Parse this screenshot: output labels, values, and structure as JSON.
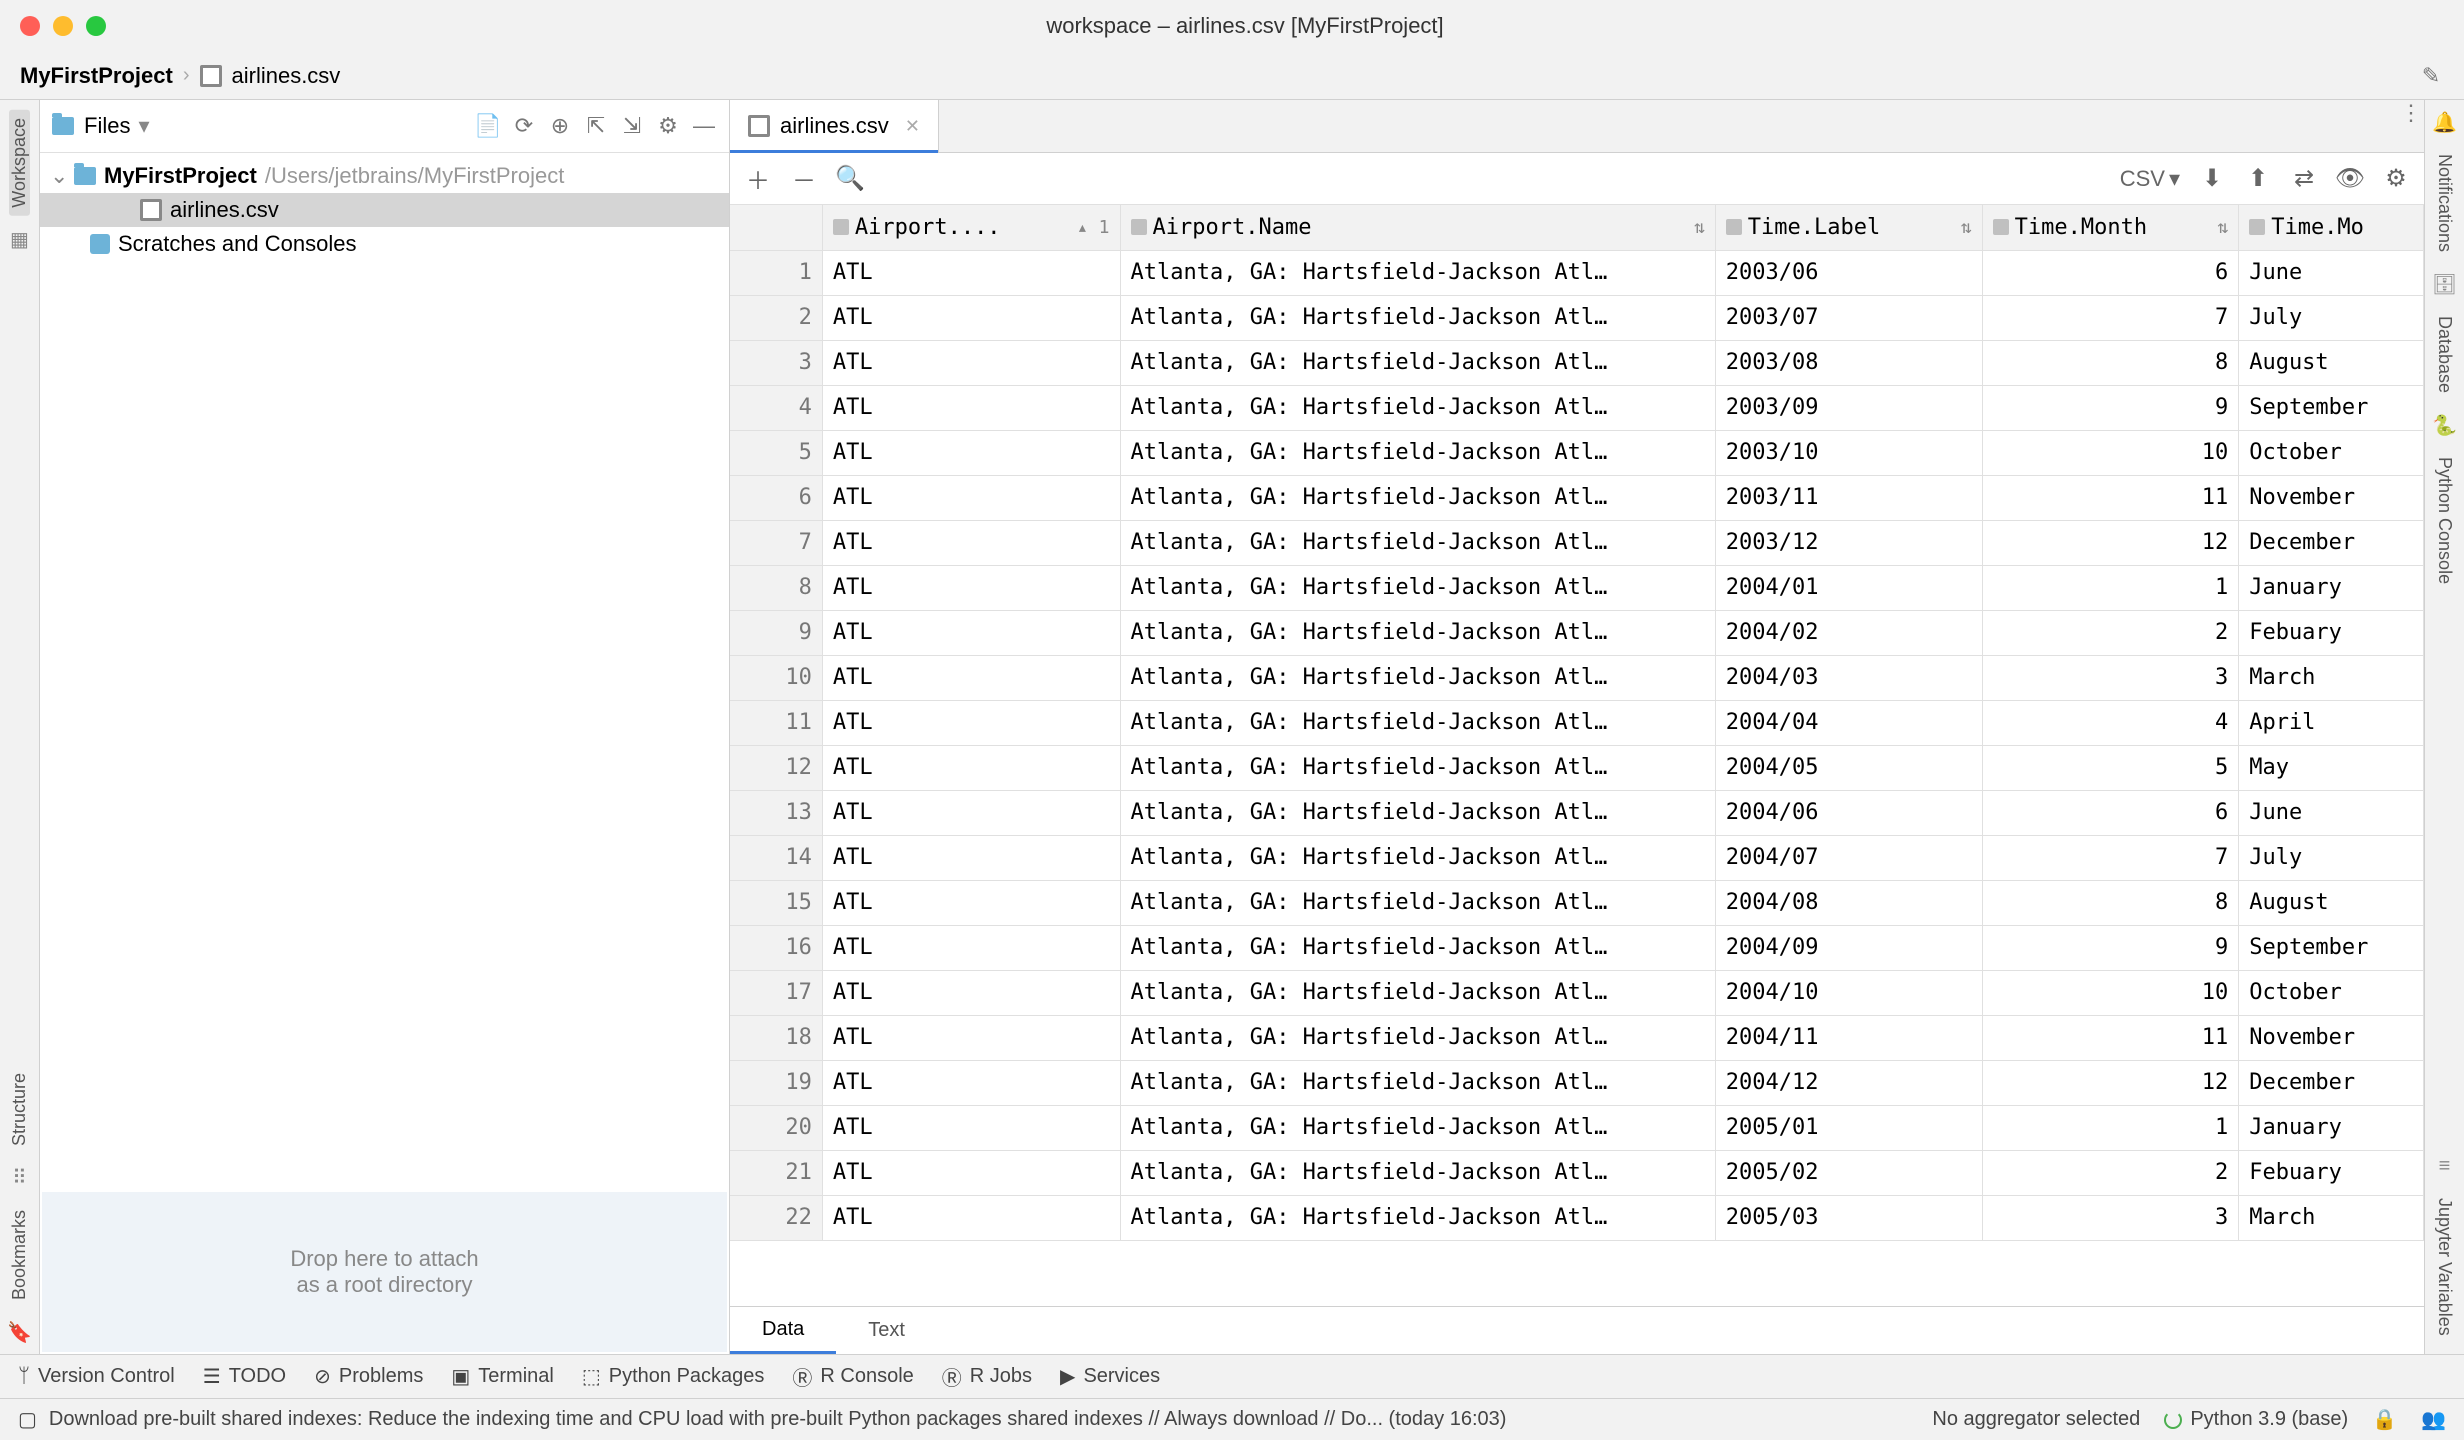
{
  "titlebar": {
    "title": "workspace – airlines.csv [MyFirstProject]"
  },
  "breadcrumb": {
    "project": "MyFirstProject",
    "file": "airlines.csv"
  },
  "left_strip": {
    "workspace": "Workspace",
    "structure": "Structure",
    "bookmarks": "Bookmarks"
  },
  "right_strip": {
    "notifications": "Notifications",
    "database": "Database",
    "python_console": "Python Console",
    "jupyter_variables": "Jupyter Variables"
  },
  "project_panel": {
    "selector_label": "Files",
    "root": "MyFirstProject",
    "root_path": "/Users/jetbrains/MyFirstProject",
    "file": "airlines.csv",
    "scratches": "Scratches and Consoles",
    "drop_line1": "Drop here to attach",
    "drop_line2": "as a root directory"
  },
  "editor": {
    "tab_label": "airlines.csv",
    "csv_label": "CSV"
  },
  "columns": {
    "c1": "Airport....",
    "c1_sort": "1",
    "c2": "Airport.Name",
    "c3": "Time.Label",
    "c4": "Time.Month",
    "c5": "Time.Mo"
  },
  "rows": [
    {
      "n": "1",
      "code": "ATL",
      "name": "Atlanta, GA: Hartsfield-Jackson Atl…",
      "label": "2003/06",
      "month": "6",
      "moname": "June"
    },
    {
      "n": "2",
      "code": "ATL",
      "name": "Atlanta, GA: Hartsfield-Jackson Atl…",
      "label": "2003/07",
      "month": "7",
      "moname": "July"
    },
    {
      "n": "3",
      "code": "ATL",
      "name": "Atlanta, GA: Hartsfield-Jackson Atl…",
      "label": "2003/08",
      "month": "8",
      "moname": "August"
    },
    {
      "n": "4",
      "code": "ATL",
      "name": "Atlanta, GA: Hartsfield-Jackson Atl…",
      "label": "2003/09",
      "month": "9",
      "moname": "September"
    },
    {
      "n": "5",
      "code": "ATL",
      "name": "Atlanta, GA: Hartsfield-Jackson Atl…",
      "label": "2003/10",
      "month": "10",
      "moname": "October"
    },
    {
      "n": "6",
      "code": "ATL",
      "name": "Atlanta, GA: Hartsfield-Jackson Atl…",
      "label": "2003/11",
      "month": "11",
      "moname": "November"
    },
    {
      "n": "7",
      "code": "ATL",
      "name": "Atlanta, GA: Hartsfield-Jackson Atl…",
      "label": "2003/12",
      "month": "12",
      "moname": "December"
    },
    {
      "n": "8",
      "code": "ATL",
      "name": "Atlanta, GA: Hartsfield-Jackson Atl…",
      "label": "2004/01",
      "month": "1",
      "moname": "January"
    },
    {
      "n": "9",
      "code": "ATL",
      "name": "Atlanta, GA: Hartsfield-Jackson Atl…",
      "label": "2004/02",
      "month": "2",
      "moname": "Febuary"
    },
    {
      "n": "10",
      "code": "ATL",
      "name": "Atlanta, GA: Hartsfield-Jackson Atl…",
      "label": "2004/03",
      "month": "3",
      "moname": "March"
    },
    {
      "n": "11",
      "code": "ATL",
      "name": "Atlanta, GA: Hartsfield-Jackson Atl…",
      "label": "2004/04",
      "month": "4",
      "moname": "April"
    },
    {
      "n": "12",
      "code": "ATL",
      "name": "Atlanta, GA: Hartsfield-Jackson Atl…",
      "label": "2004/05",
      "month": "5",
      "moname": "May"
    },
    {
      "n": "13",
      "code": "ATL",
      "name": "Atlanta, GA: Hartsfield-Jackson Atl…",
      "label": "2004/06",
      "month": "6",
      "moname": "June"
    },
    {
      "n": "14",
      "code": "ATL",
      "name": "Atlanta, GA: Hartsfield-Jackson Atl…",
      "label": "2004/07",
      "month": "7",
      "moname": "July"
    },
    {
      "n": "15",
      "code": "ATL",
      "name": "Atlanta, GA: Hartsfield-Jackson Atl…",
      "label": "2004/08",
      "month": "8",
      "moname": "August"
    },
    {
      "n": "16",
      "code": "ATL",
      "name": "Atlanta, GA: Hartsfield-Jackson Atl…",
      "label": "2004/09",
      "month": "9",
      "moname": "September"
    },
    {
      "n": "17",
      "code": "ATL",
      "name": "Atlanta, GA: Hartsfield-Jackson Atl…",
      "label": "2004/10",
      "month": "10",
      "moname": "October"
    },
    {
      "n": "18",
      "code": "ATL",
      "name": "Atlanta, GA: Hartsfield-Jackson Atl…",
      "label": "2004/11",
      "month": "11",
      "moname": "November"
    },
    {
      "n": "19",
      "code": "ATL",
      "name": "Atlanta, GA: Hartsfield-Jackson Atl…",
      "label": "2004/12",
      "month": "12",
      "moname": "December"
    },
    {
      "n": "20",
      "code": "ATL",
      "name": "Atlanta, GA: Hartsfield-Jackson Atl…",
      "label": "2005/01",
      "month": "1",
      "moname": "January"
    },
    {
      "n": "21",
      "code": "ATL",
      "name": "Atlanta, GA: Hartsfield-Jackson Atl…",
      "label": "2005/02",
      "month": "2",
      "moname": "Febuary"
    },
    {
      "n": "22",
      "code": "ATL",
      "name": "Atlanta, GA: Hartsfield-Jackson Atl…",
      "label": "2005/03",
      "month": "3",
      "moname": "March"
    }
  ],
  "view_tabs": {
    "data": "Data",
    "text": "Text"
  },
  "bottom_toolbar": {
    "version_control": "Version Control",
    "todo": "TODO",
    "problems": "Problems",
    "terminal": "Terminal",
    "python_packages": "Python Packages",
    "r_console": "R Console",
    "r_jobs": "R Jobs",
    "services": "Services"
  },
  "status": {
    "message": "Download pre-built shared indexes: Reduce the indexing time and CPU load with pre-built Python packages shared indexes // Always download // Do... (today 16:03)",
    "aggregator": "No aggregator selected",
    "python": "Python 3.9 (base)"
  }
}
